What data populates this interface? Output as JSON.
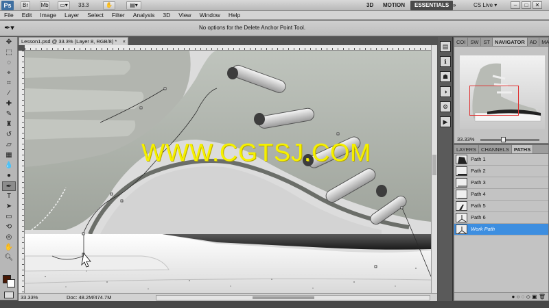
{
  "app": {
    "logo": "Ps",
    "zoom": "33.3",
    "workspaces": [
      "3D",
      "MOTION",
      "ESSENTIALS"
    ],
    "active_workspace": "ESSENTIALS",
    "cs_live": "CS Live",
    "window_controls": [
      "–",
      "□",
      "✕"
    ]
  },
  "menu": [
    "File",
    "Edit",
    "Image",
    "Layer",
    "Select",
    "Filter",
    "Analysis",
    "3D",
    "View",
    "Window",
    "Help"
  ],
  "options_bar": {
    "message": "No options for the Delete Anchor Point Tool."
  },
  "document": {
    "tab_title": "Lesson1.psd @ 33.3% (Layer 8, RGB/8) *",
    "close": "×",
    "watermark": "WWW.CGTSJ.COM",
    "status_zoom": "33.33%",
    "status_doc": "Doc: 48.2M/474.7M"
  },
  "navigator": {
    "tabs": [
      "COI",
      "SW",
      "ST",
      "NAVIGATOR",
      "AD",
      "MA"
    ],
    "active_tab": "NAVIGATOR",
    "zoom": "33.33%"
  },
  "paths_panel": {
    "tabs": [
      "LAYERS",
      "CHANNELS",
      "PATHS"
    ],
    "active_tab": "PATHS",
    "paths": [
      "Path 1",
      "Path 2",
      "Path 3",
      "Path 4",
      "Path 5",
      "Path 6",
      "Work Path"
    ],
    "selected": "Work Path"
  },
  "colors": {
    "foreground": "#4a1a06",
    "background": "#ffffff",
    "selection": "#3d8ee0",
    "watermark": "#f5f000"
  }
}
